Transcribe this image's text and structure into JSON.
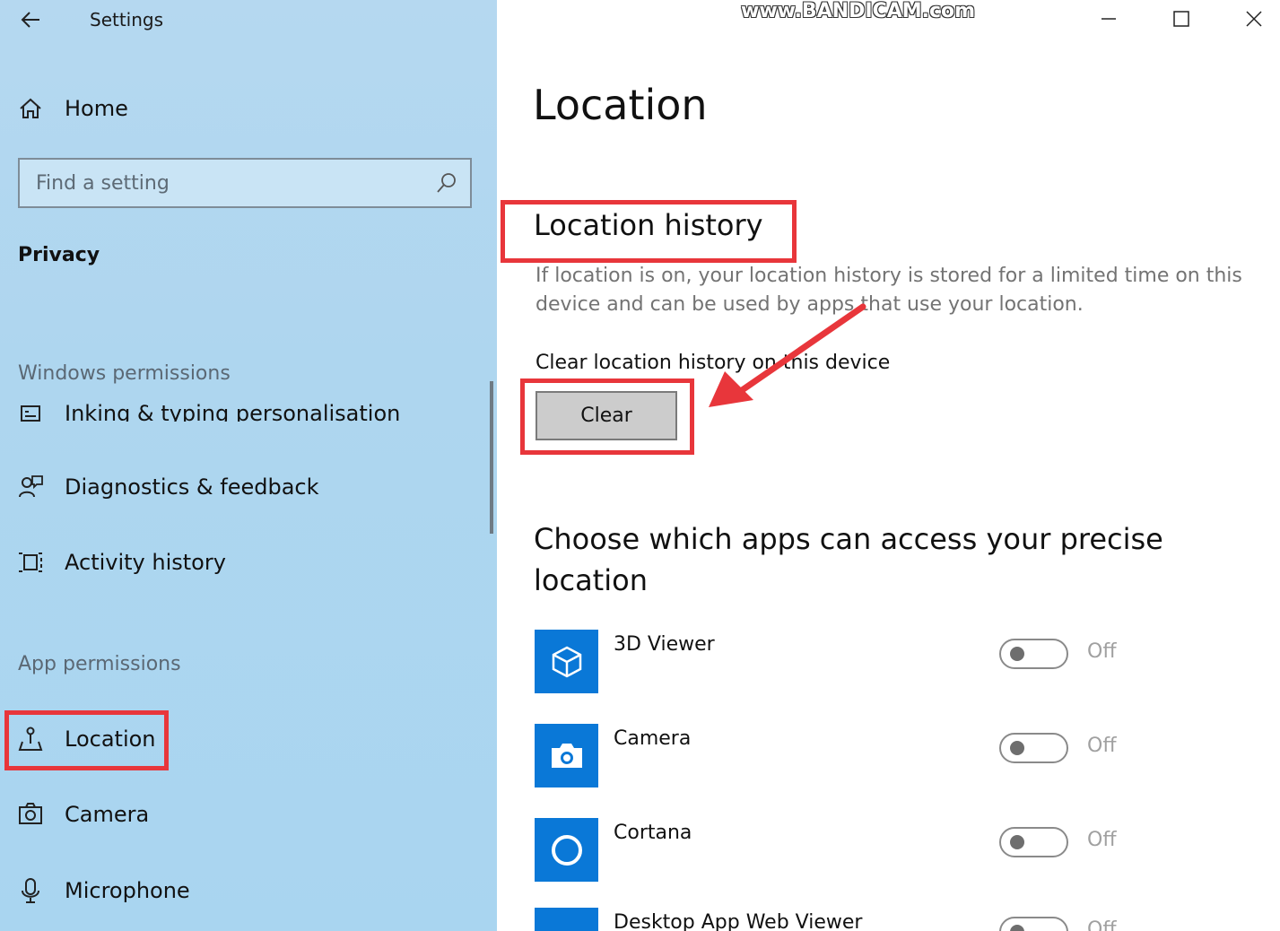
{
  "sidebar": {
    "app_title": "Settings",
    "home_label": "Home",
    "search_placeholder": "Find a setting",
    "section_title": "Privacy",
    "windows_permissions_label": "Windows permissions",
    "windows_items": [
      {
        "label": "Inking & typing personalisation",
        "icon": "inking-icon"
      },
      {
        "label": "Diagnostics & feedback",
        "icon": "diagnostics-icon"
      },
      {
        "label": "Activity history",
        "icon": "activity-icon"
      }
    ],
    "app_permissions_label": "App permissions",
    "app_items": [
      {
        "label": "Location",
        "icon": "location-icon",
        "selected": true
      },
      {
        "label": "Camera",
        "icon": "camera-icon"
      },
      {
        "label": "Microphone",
        "icon": "microphone-icon"
      }
    ]
  },
  "watermark": "www.BANDICAM.com",
  "main": {
    "page_title": "Location",
    "location_history": {
      "heading": "Location history",
      "description": "If location is on, your location history is stored for a limited time on this device and can be used by apps that use your location.",
      "clear_label": "Clear location history on this device",
      "clear_button": "Clear"
    },
    "precise_heading": "Choose which apps can access your precise location",
    "apps": [
      {
        "name": "3D Viewer",
        "state": "Off",
        "icon": "cube-icon"
      },
      {
        "name": "Camera",
        "state": "Off",
        "icon": "camera-app-icon"
      },
      {
        "name": "Cortana",
        "state": "Off",
        "icon": "cortana-icon"
      },
      {
        "name": "Desktop App Web Viewer",
        "state": "Off",
        "icon": "web-viewer-icon"
      }
    ]
  },
  "colors": {
    "accent": "#0a78d7",
    "highlight_red": "#e8363b",
    "sidebar_bg": "#aed6ef"
  }
}
